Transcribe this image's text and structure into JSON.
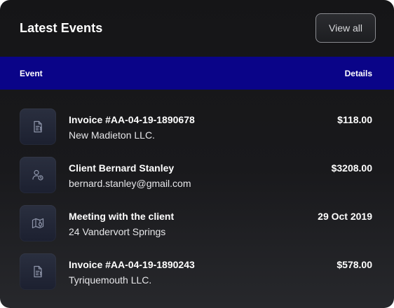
{
  "card": {
    "title": "Latest Events",
    "view_all_label": "View all"
  },
  "table": {
    "headers": {
      "event": "Event",
      "details": "Details"
    },
    "rows": [
      {
        "icon": "invoice-icon",
        "title": "Invoice #AA-04-19-1890678",
        "subtitle": "New Madieton LLC.",
        "detail": "$118.00"
      },
      {
        "icon": "client-icon",
        "title": "Client Bernard Stanley",
        "subtitle": "bernard.stanley@gmail.com",
        "detail": "$3208.00"
      },
      {
        "icon": "map-icon",
        "title": "Meeting with the client",
        "subtitle": "24 Vandervort Springs",
        "detail": "29 Oct 2019"
      },
      {
        "icon": "invoice-icon",
        "title": "Invoice #AA-04-19-1890243",
        "subtitle": "Tyriquemouth LLC.",
        "detail": "$578.00"
      }
    ]
  },
  "colors": {
    "card_background": "#19191c",
    "table_header": "#0a0488",
    "icon_stroke": "#8f96ab",
    "icon_tile": "#232838"
  }
}
